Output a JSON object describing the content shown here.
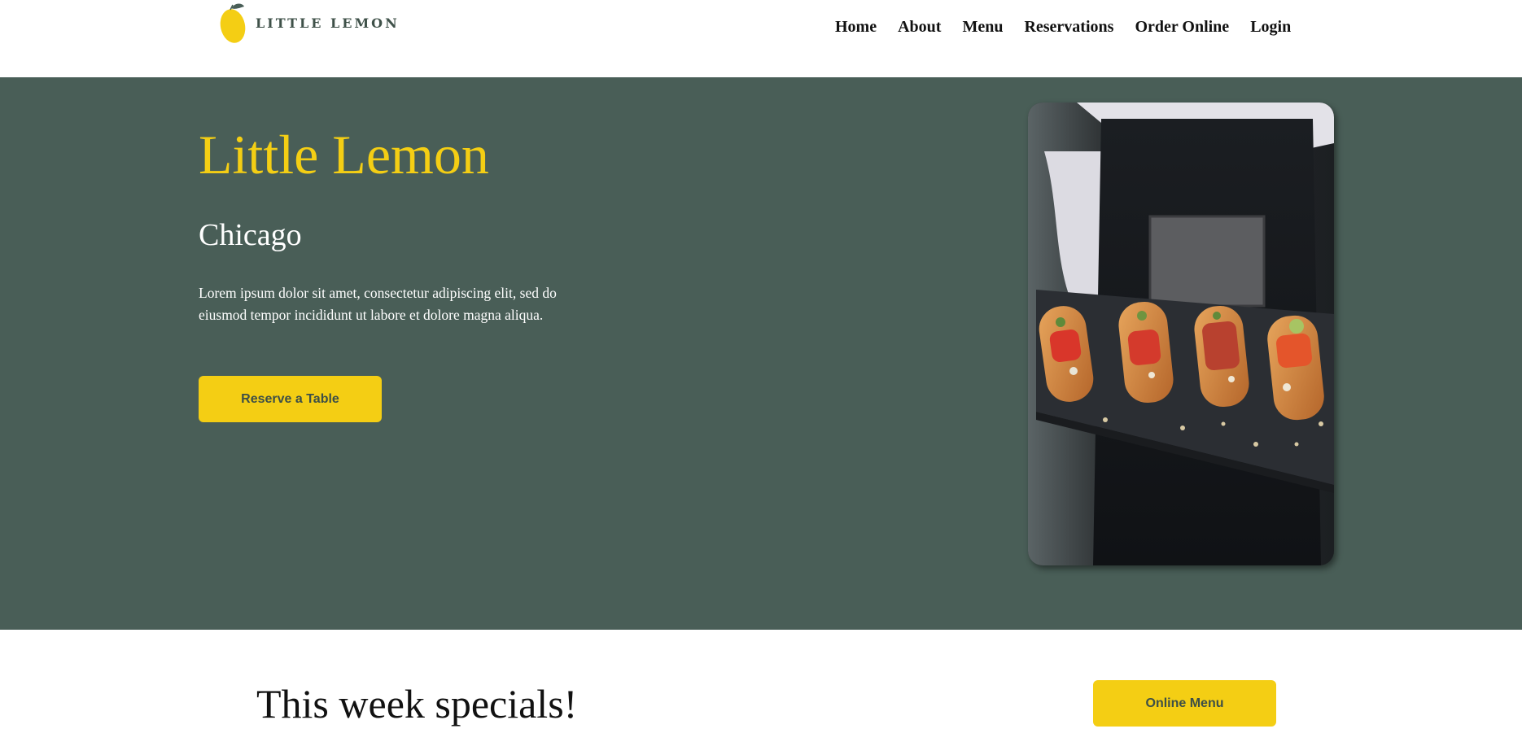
{
  "brand": {
    "logo_text": "LITTLE LEMON",
    "colors": {
      "primary_green": "#495e57",
      "primary_yellow": "#f4ce14",
      "dark_text": "#333333"
    }
  },
  "nav": {
    "items": [
      {
        "label": "Home"
      },
      {
        "label": "About"
      },
      {
        "label": "Menu"
      },
      {
        "label": "Reservations"
      },
      {
        "label": "Order Online"
      },
      {
        "label": "Login"
      }
    ]
  },
  "hero": {
    "title": "Little Lemon",
    "subtitle": "Chicago",
    "description": "Lorem ipsum dolor sit amet, consectetur adipiscing elit, sed do eiusmod tempor incididunt ut labore et dolore magna aliqua.",
    "cta_label": "Reserve a Table",
    "image_icon": "restaurant-food-image"
  },
  "specials": {
    "title": "This week specials!",
    "button_label": "Online Menu"
  }
}
